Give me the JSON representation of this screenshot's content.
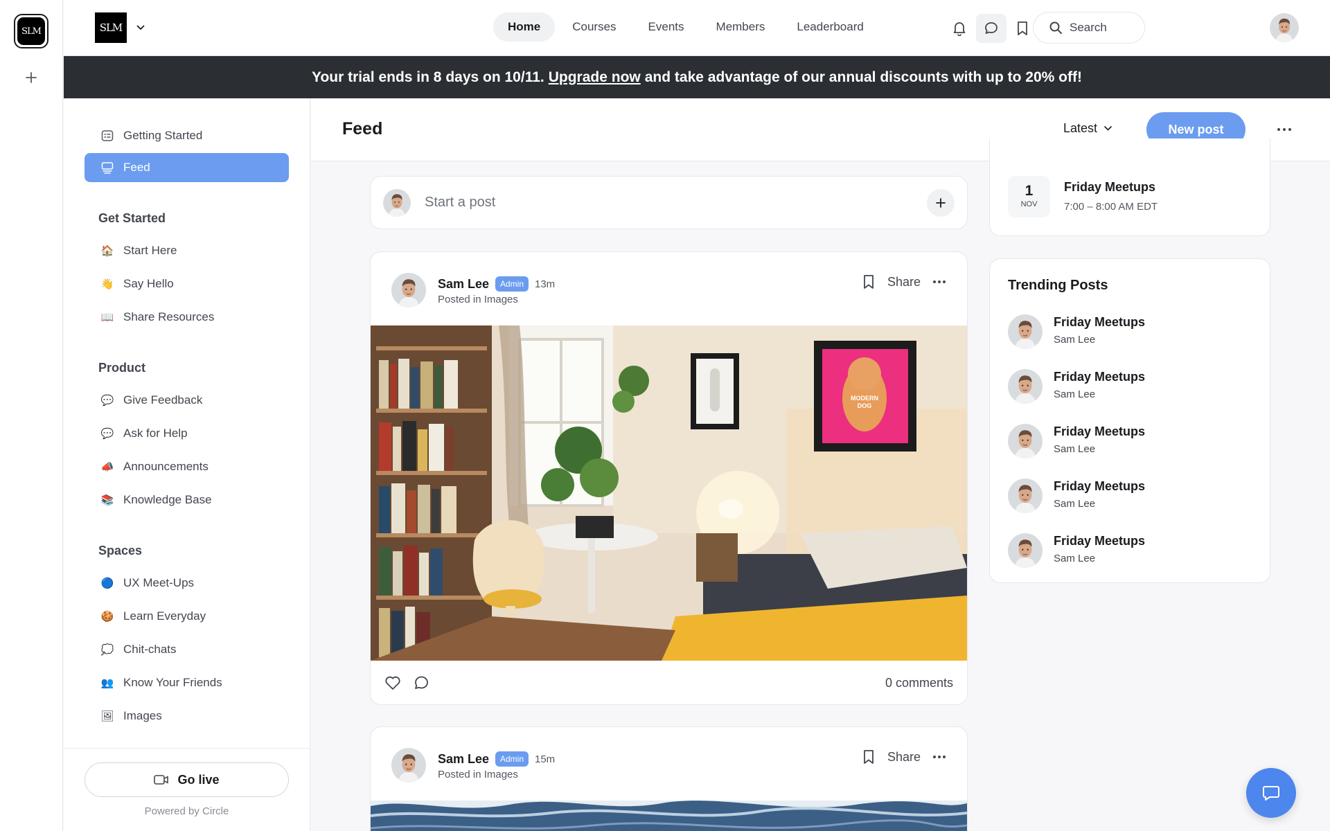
{
  "rail": {
    "logo_text": "SLM",
    "add_icon": "plus-icon"
  },
  "header": {
    "brand_text": "SLM",
    "nav": [
      {
        "label": "Home",
        "active": true
      },
      {
        "label": "Courses"
      },
      {
        "label": "Events"
      },
      {
        "label": "Members"
      },
      {
        "label": "Leaderboard"
      }
    ],
    "search_label": "Search",
    "icons": [
      "bell-icon",
      "chat-bubble-icon",
      "bookmark-icon"
    ]
  },
  "banner": {
    "text_before": "Your trial ends in 8 days on 10/11.",
    "link": "Upgrade now",
    "text_after": "and take advantage of our annual discounts with up to 20% off!"
  },
  "sidebar": {
    "top_items": [
      {
        "label": "Getting Started",
        "icon": "checklist-icon"
      },
      {
        "label": "Feed",
        "icon": "feed-icon",
        "active": true
      }
    ],
    "sections": [
      {
        "heading": "Get Started",
        "items": [
          {
            "label": "Start Here",
            "emoji": "🏠"
          },
          {
            "label": "Say Hello",
            "emoji": "👋"
          },
          {
            "label": "Share Resources",
            "emoji": "📖"
          }
        ]
      },
      {
        "heading": "Product",
        "items": [
          {
            "label": "Give Feedback",
            "emoji": "💬"
          },
          {
            "label": "Ask for Help",
            "emoji": "💬"
          },
          {
            "label": "Announcements",
            "emoji": "📣"
          },
          {
            "label": "Knowledge Base",
            "emoji": "📚"
          }
        ]
      },
      {
        "heading": "Spaces",
        "items": [
          {
            "label": "UX Meet-Ups",
            "emoji": "🔵"
          },
          {
            "label": "Learn Everyday",
            "emoji": "🍪"
          },
          {
            "label": "Chit-chats",
            "emoji": "💭"
          },
          {
            "label": "Know Your Friends",
            "emoji": "👥"
          },
          {
            "label": "Images",
            "emoji": "🖼"
          }
        ]
      }
    ],
    "go_live": "Go live",
    "powered_by": "Powered by Circle"
  },
  "feed": {
    "title": "Feed",
    "sort_label": "Latest",
    "new_post_label": "New post",
    "composer_placeholder": "Start a post"
  },
  "posts": [
    {
      "author": "Sam Lee",
      "badge": "Admin",
      "time": "13m",
      "space": "Posted in Images",
      "share": "Share",
      "comments": "0 comments"
    },
    {
      "author": "Sam Lee",
      "badge": "Admin",
      "time": "15m",
      "space": "Posted in Images",
      "share": "Share"
    }
  ],
  "event": {
    "day": "1",
    "month": "NOV",
    "title": "Friday Meetups",
    "time": "7:00 – 8:00 AM EDT"
  },
  "trending": {
    "title": "Trending Posts",
    "items": [
      {
        "title": "Friday Meetups",
        "author": "Sam Lee"
      },
      {
        "title": "Friday Meetups",
        "author": "Sam Lee"
      },
      {
        "title": "Friday Meetups",
        "author": "Sam Lee"
      },
      {
        "title": "Friday Meetups",
        "author": "Sam Lee"
      },
      {
        "title": "Friday Meetups",
        "author": "Sam Lee"
      }
    ]
  },
  "colors": {
    "accent": "#6b9cf0",
    "banner": "#2b2e33",
    "fab": "#4d86ec"
  }
}
